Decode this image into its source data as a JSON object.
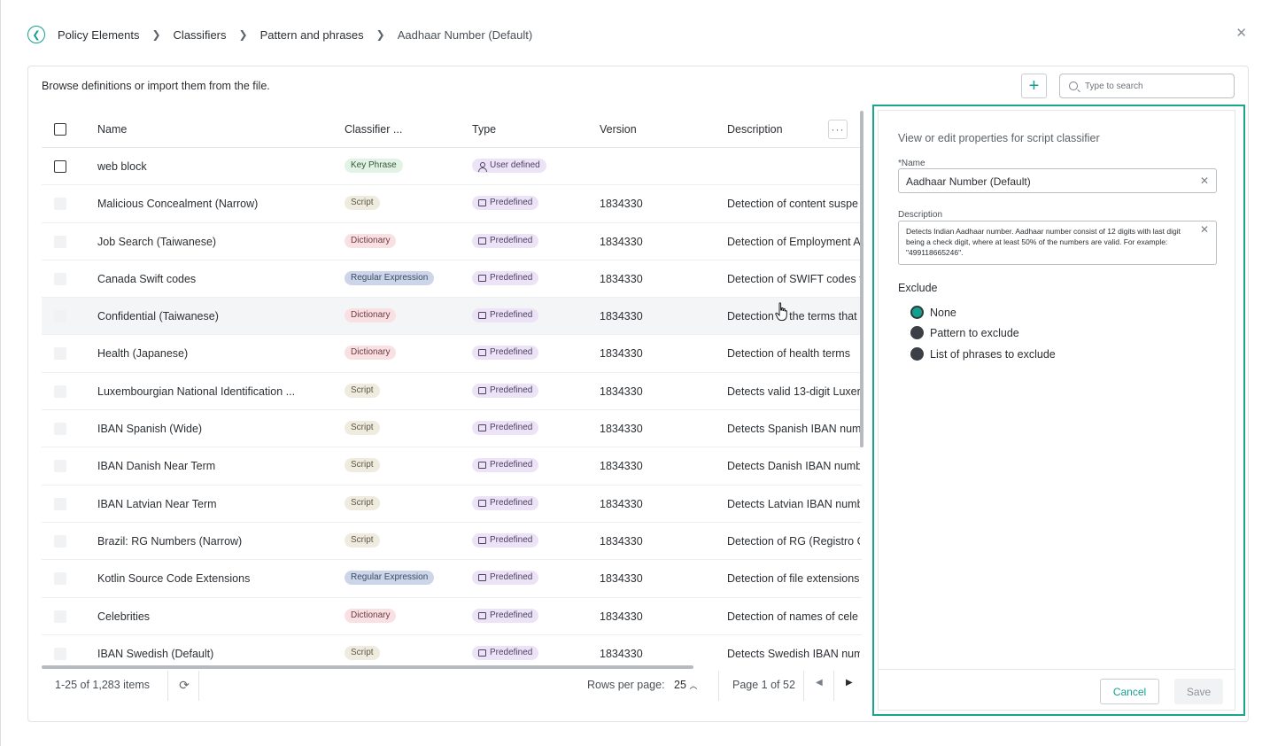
{
  "breadcrumb": {
    "items": [
      "Policy Elements",
      "Classifiers",
      "Pattern and phrases",
      "Aadhaar Number (Default)"
    ]
  },
  "card": {
    "header_text": "Browse definitions or import them from the file.",
    "search_placeholder": "Type to search"
  },
  "table": {
    "columns": [
      "Name",
      "Classifier ...",
      "Type",
      "Version",
      "Description"
    ],
    "rows": [
      {
        "name": "web block",
        "classifier": "Key Phrase",
        "type": "User defined",
        "version": "",
        "description": ""
      },
      {
        "name": "Malicious Concealment (Narrow)",
        "classifier": "Script",
        "type": "Predefined",
        "version": "1834330",
        "description": "Detection of content suspe"
      },
      {
        "name": "Job Search (Taiwanese)",
        "classifier": "Dictionary",
        "type": "Predefined",
        "version": "1834330",
        "description": "Detection of Employment A"
      },
      {
        "name": "Canada Swift codes",
        "classifier": "Regular Expression",
        "type": "Predefined",
        "version": "1834330",
        "description": "Detection of SWIFT codes f"
      },
      {
        "name": "Confidential (Taiwanese)",
        "classifier": "Dictionary",
        "type": "Predefined",
        "version": "1834330",
        "description": "Detection of the terms that"
      },
      {
        "name": "Health (Japanese)",
        "classifier": "Dictionary",
        "type": "Predefined",
        "version": "1834330",
        "description": "Detection of health terms"
      },
      {
        "name": "Luxembourgian National Identification ...",
        "classifier": "Script",
        "type": "Predefined",
        "version": "1834330",
        "description": "Detects valid 13-digit Luxer"
      },
      {
        "name": "IBAN Spanish (Wide)",
        "classifier": "Script",
        "type": "Predefined",
        "version": "1834330",
        "description": "Detects Spanish IBAN numb"
      },
      {
        "name": "IBAN Danish Near Term",
        "classifier": "Script",
        "type": "Predefined",
        "version": "1834330",
        "description": "Detects Danish IBAN numb"
      },
      {
        "name": "IBAN Latvian Near Term",
        "classifier": "Script",
        "type": "Predefined",
        "version": "1834330",
        "description": "Detects Latvian IBAN numb"
      },
      {
        "name": "Brazil: RG Numbers (Narrow)",
        "classifier": "Script",
        "type": "Predefined",
        "version": "1834330",
        "description": "Detection of RG (Registro G"
      },
      {
        "name": "Kotlin Source Code Extensions",
        "classifier": "Regular Expression",
        "type": "Predefined",
        "version": "1834330",
        "description": "Detection of file extensions"
      },
      {
        "name": "Celebrities",
        "classifier": "Dictionary",
        "type": "Predefined",
        "version": "1834330",
        "description": "Detection of names of cele"
      },
      {
        "name": "IBAN Swedish (Default)",
        "classifier": "Script",
        "type": "Predefined",
        "version": "1834330",
        "description": "Detects Swedish IBAN num"
      }
    ]
  },
  "footer": {
    "items_count": "1-25 of 1,283 items",
    "rows_per_page_label": "Rows per page:",
    "rows_per_page_value": "25",
    "page_info": "Page 1 of 52"
  },
  "panel": {
    "title": "View or edit properties for script classifier",
    "name_label": "*Name",
    "name_value": "Aadhaar Number (Default)",
    "description_label": "Description",
    "description_value": "Detects Indian Aadhaar number. Aadhaar number consist of 12 digits with last digit being a check digit, where at least 50% of the numbers are valid. For example: \"499118665246\".",
    "exclude_label": "Exclude",
    "exclude_options": [
      "None",
      "Pattern to exclude",
      "List of phrases to exclude"
    ],
    "exclude_selected": "None",
    "cancel_label": "Cancel",
    "save_label": "Save"
  },
  "colors": {
    "accent": "#14a090",
    "panel_border": "#1aa58f"
  }
}
